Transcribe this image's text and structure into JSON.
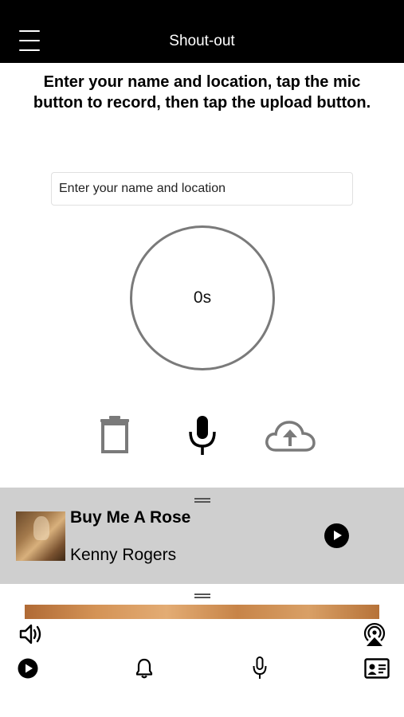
{
  "header": {
    "title": "Shout-out",
    "menu_icon": "hamburger-menu-icon"
  },
  "instructions": "Enter your name and location, tap the mic button to record, then tap the upload button.",
  "name_input": {
    "placeholder": "Enter your name and location",
    "value": ""
  },
  "recorder": {
    "elapsed": "0s"
  },
  "controls": {
    "delete_icon": "trash-icon",
    "record_icon": "microphone-icon",
    "upload_icon": "cloud-upload-icon"
  },
  "now_playing": {
    "title": "Buy Me A Rose",
    "artist": "Kenny Rogers",
    "play_icon": "play-icon"
  },
  "player_bar": {
    "volume_icon": "speaker-volume-icon",
    "airplay_icon": "airplay-icon"
  },
  "tabs": [
    {
      "name": "play",
      "icon": "play-circle-icon"
    },
    {
      "name": "notifications",
      "icon": "bell-icon"
    },
    {
      "name": "shout-out",
      "icon": "microphone-icon"
    },
    {
      "name": "contact",
      "icon": "contact-card-icon"
    }
  ],
  "colors": {
    "header_bg": "#000000",
    "panel_bg": "#cfcfcf",
    "icon_gray": "#7a7a7a"
  }
}
